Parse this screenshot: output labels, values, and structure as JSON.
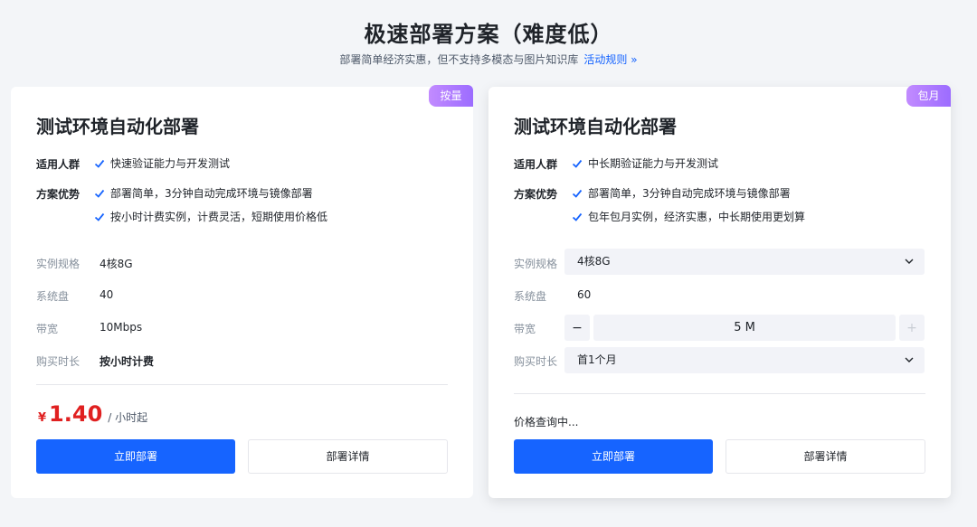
{
  "header": {
    "title": "极速部署方案（难度低）",
    "subtitle": "部署简单经济实惠，但不支持多模态与图片知识库",
    "link": "活动规则 »"
  },
  "cards": [
    {
      "badge": "按量",
      "title": "测试环境自动化部署",
      "audience_label": "适用人群",
      "audience": [
        "快速验证能力与开发测试"
      ],
      "advantages_label": "方案优势",
      "advantages": [
        "部署简单，3分钟自动完成环境与镜像部署",
        "按小时计费实例，计费灵活，短期使用价格低"
      ],
      "specs": {
        "instance_label": "实例规格",
        "instance_value": "4核8G",
        "disk_label": "系统盘",
        "disk_value": "40",
        "bandwidth_label": "带宽",
        "bandwidth_value": "10Mbps",
        "duration_label": "购买时长",
        "duration_value": "按小时计费"
      },
      "price": {
        "currency": "¥",
        "amount": "1.40",
        "unit": "/ 小时起"
      },
      "deploy_button": "立即部署",
      "details_button": "部署详情"
    },
    {
      "badge": "包月",
      "title": "测试环境自动化部署",
      "audience_label": "适用人群",
      "audience": [
        "中长期验证能力与开发测试"
      ],
      "advantages_label": "方案优势",
      "advantages": [
        "部署简单，3分钟自动完成环境与镜像部署",
        "包年包月实例，经济实惠，中长期使用更划算"
      ],
      "specs": {
        "instance_label": "实例规格",
        "instance_value": "4核8G",
        "disk_label": "系统盘",
        "disk_value": "60",
        "bandwidth_label": "带宽",
        "bandwidth_value": "5 M",
        "bandwidth_minus": "−",
        "bandwidth_plus": "+",
        "duration_label": "购买时长",
        "duration_value": "首1个月"
      },
      "price_status": "价格查询中...",
      "deploy_button": "立即部署",
      "details_button": "部署详情"
    }
  ],
  "colors": {
    "primary": "#1664ff",
    "price": "#e02020",
    "badge": "#a874ff"
  }
}
